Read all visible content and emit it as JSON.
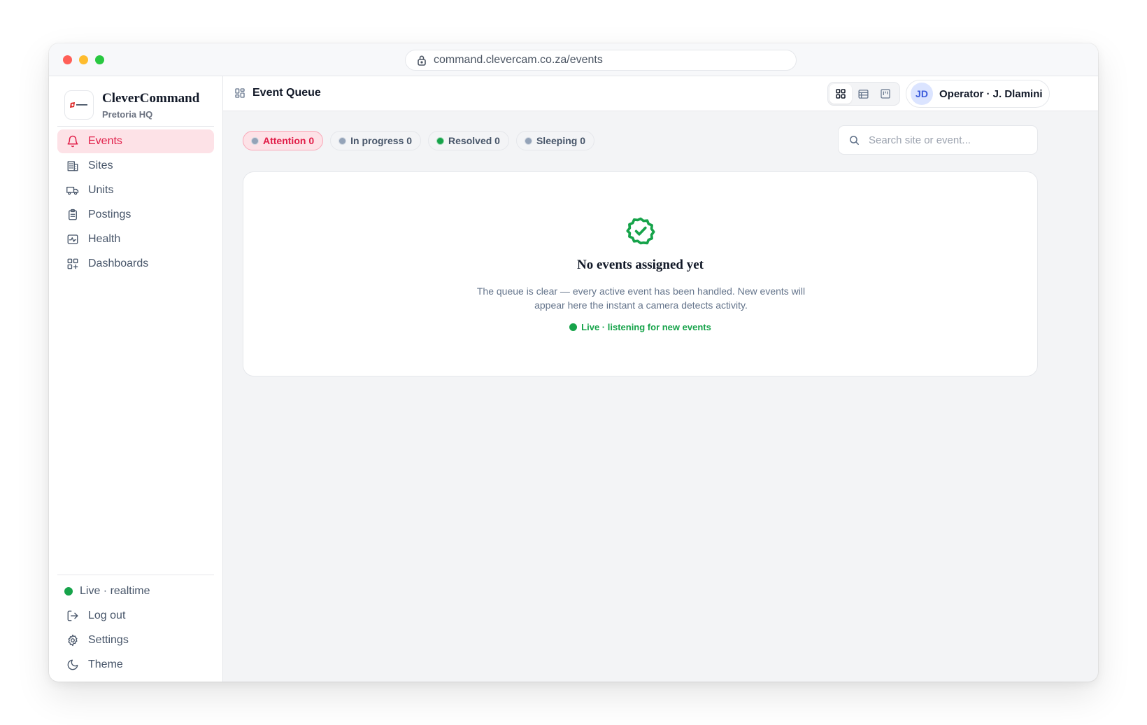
{
  "browser": {
    "url": "command.clevercam.co.za/events"
  },
  "brand": {
    "name": "CleverCommand",
    "subtitle": "Pretoria HQ"
  },
  "sidebar": {
    "items": [
      {
        "label": "Events",
        "icon": "bell-icon",
        "active": true
      },
      {
        "label": "Sites",
        "icon": "building-icon",
        "active": false
      },
      {
        "label": "Units",
        "icon": "truck-icon",
        "active": false
      },
      {
        "label": "Postings",
        "icon": "clipboard-icon",
        "active": false
      },
      {
        "label": "Health",
        "icon": "activity-icon",
        "active": false
      },
      {
        "label": "Dashboards",
        "icon": "dashboard-grid-icon",
        "active": false
      }
    ],
    "bottom": {
      "live_status": "Live · realtime",
      "logout": "Log out",
      "settings": "Settings",
      "theme": "Theme"
    }
  },
  "header": {
    "title": "Event Queue",
    "view_modes": [
      "grid",
      "list",
      "board"
    ],
    "active_view": "grid",
    "user": {
      "initials": "JD",
      "name": "Operator · J. Dlamini"
    }
  },
  "filters": {
    "chips": [
      {
        "label": "Attention 0",
        "status_color": "#94a3b8",
        "active": true
      },
      {
        "label": "In progress 0",
        "status_color": "#94a3b8",
        "active": false
      },
      {
        "label": "Resolved 0",
        "status_color": "#16a34a",
        "active": false
      },
      {
        "label": "Sleeping 0",
        "status_color": "#94a3b8",
        "active": false
      }
    ]
  },
  "search": {
    "placeholder": "Search site or event...",
    "value": ""
  },
  "empty_state": {
    "icon": "badge-check-icon",
    "title": "No events assigned yet",
    "description": "The queue is clear — every active event has been handled. New events will appear here the instant a camera detects activity.",
    "live_text": "Live · listening for new events"
  },
  "colors": {
    "accent": "#e11d48",
    "accent_bg": "#fde2e7",
    "success": "#16a34a"
  }
}
